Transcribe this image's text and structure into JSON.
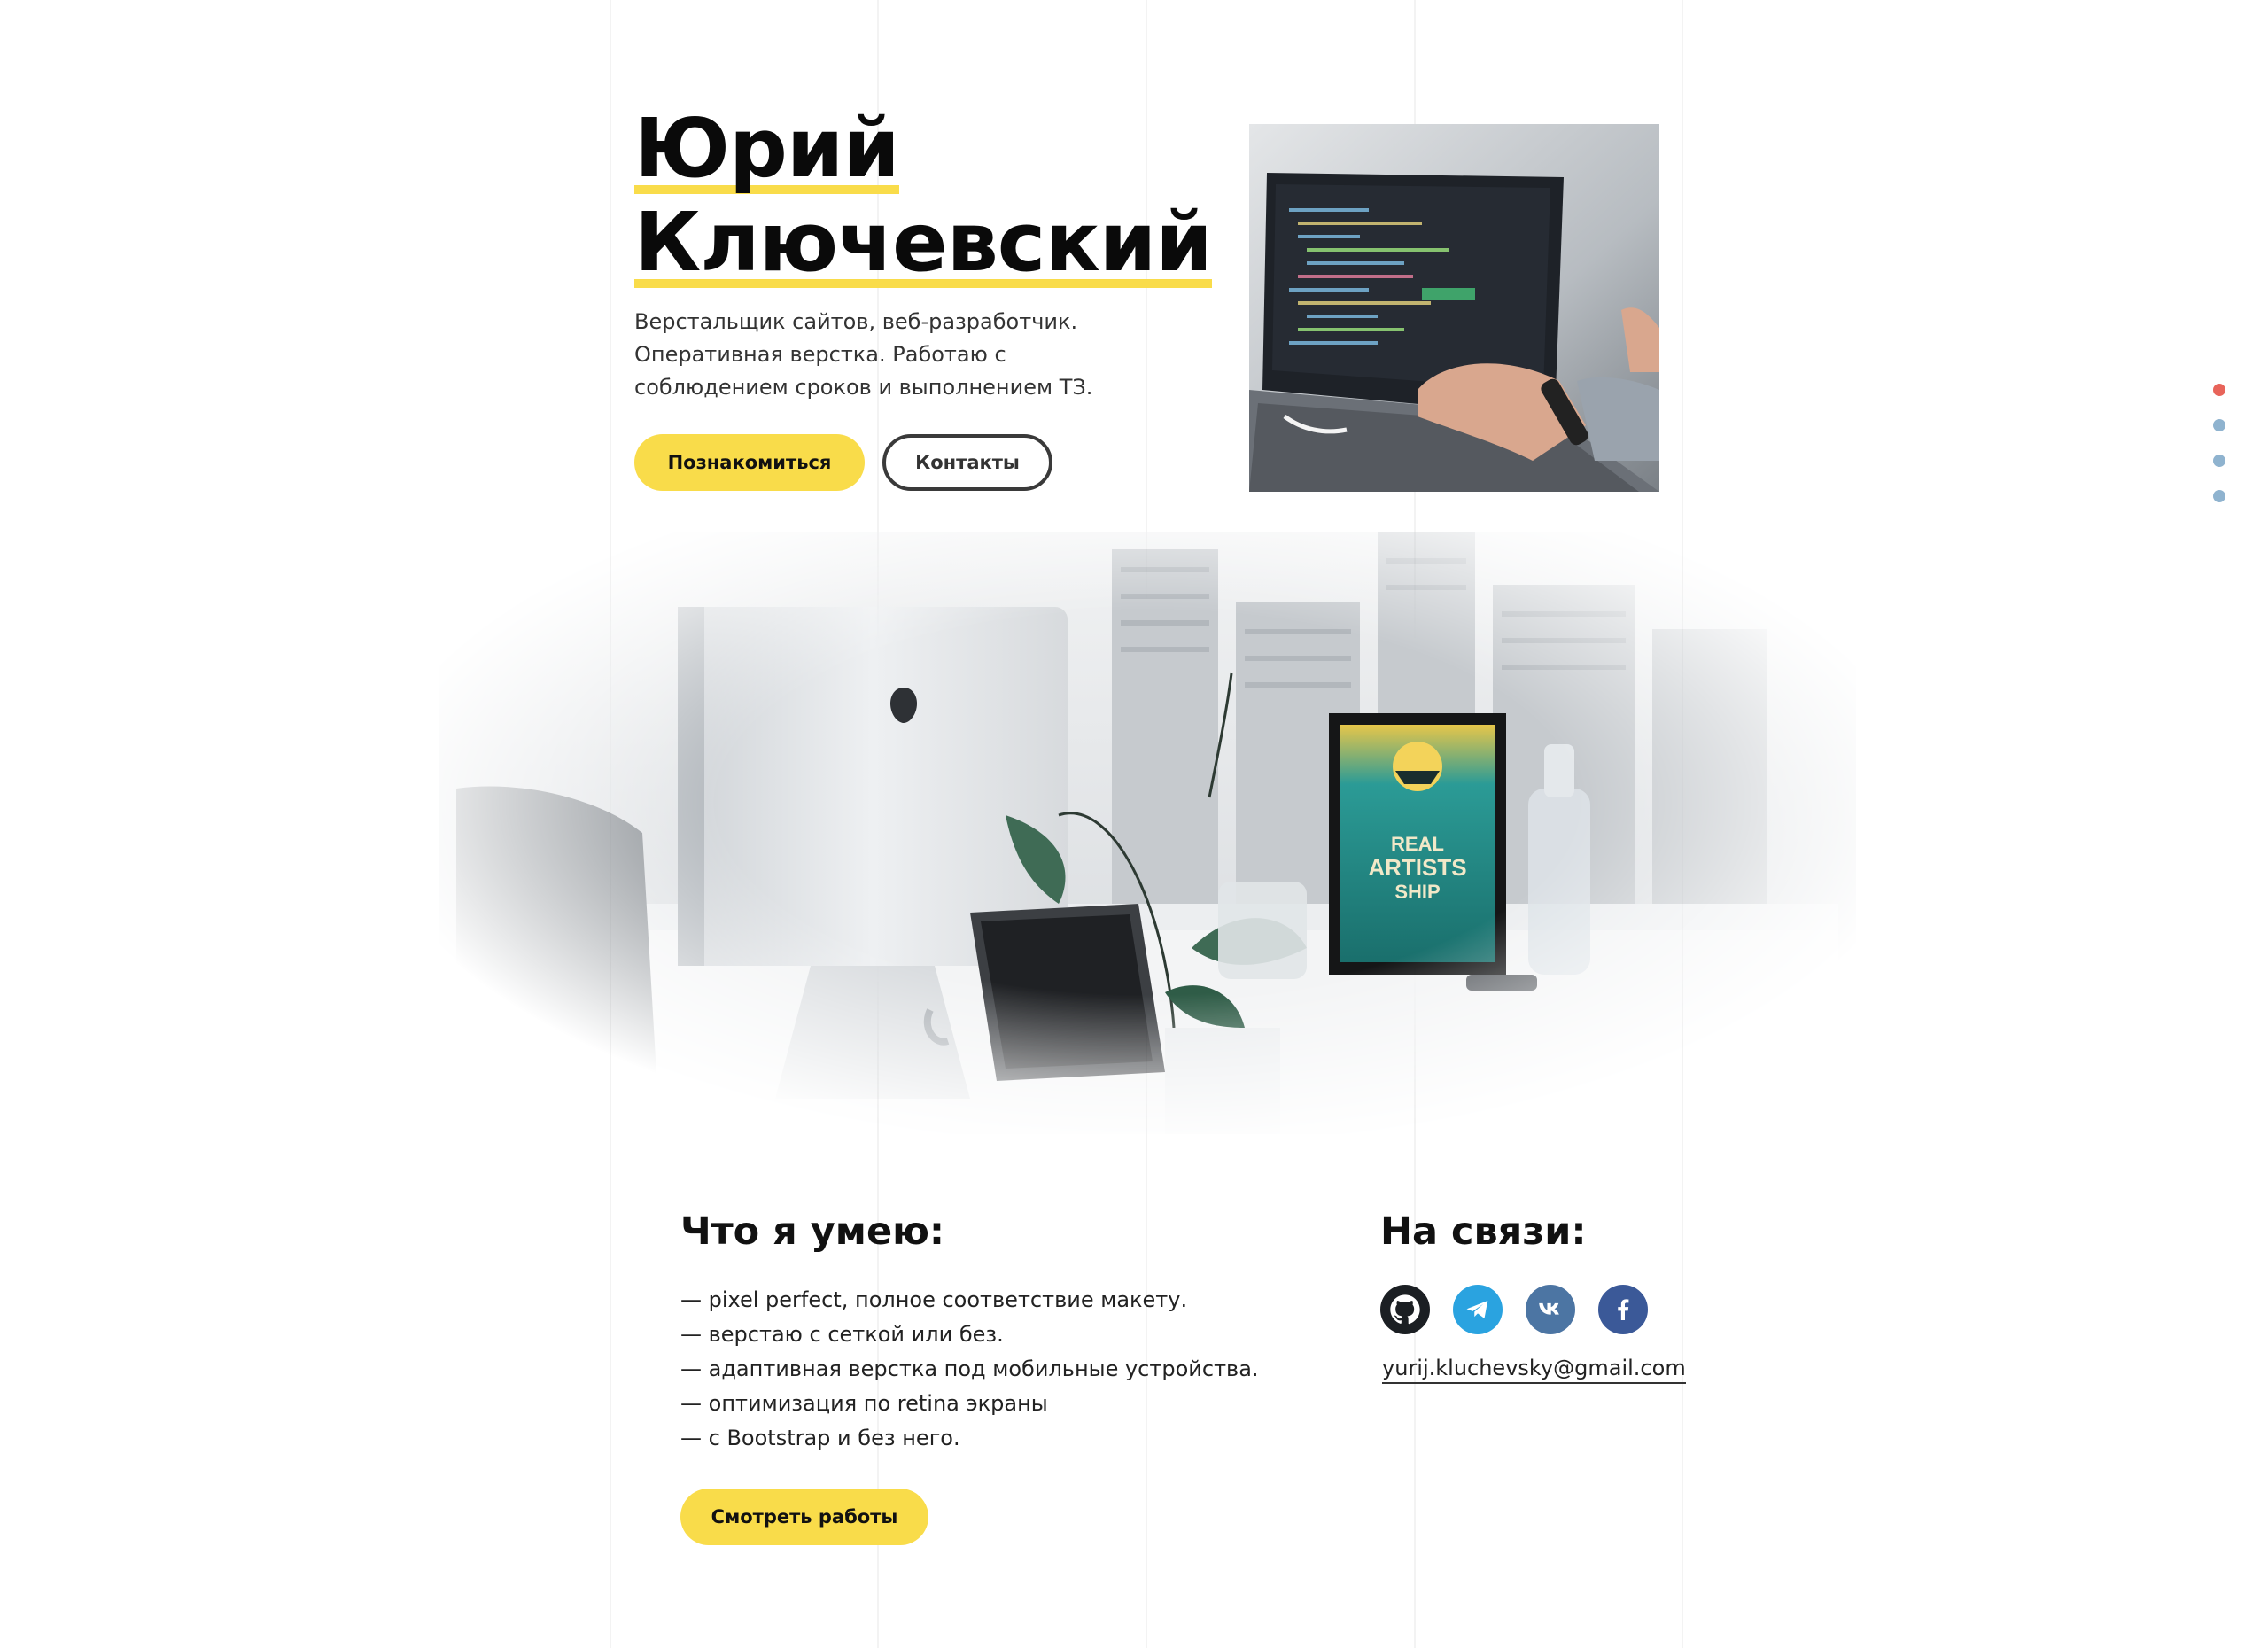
{
  "hero": {
    "name_first": "Юрий",
    "name_last": "Ключевский",
    "description": "Верстальщик сайтов, веб-разработчик. Оперативная верстка. Работаю с соблюдением сроков и выполнением ТЗ.",
    "primary_button": "Познакомиться",
    "secondary_button": "Контакты"
  },
  "side_nav": {
    "active_color": "#e8645a",
    "inactive_color": "#8fb3cf",
    "dots_count": 4
  },
  "workspace_poster": {
    "line1": "REAL",
    "line2": "ARTISTS",
    "line3": "SHIP"
  },
  "skills": {
    "title": "Что я умею:",
    "items": [
      "— pixel perfect, полное соответствие макету.",
      "— верстаю с сеткой или без.",
      "— адаптивная верстка под мобильные устройства.",
      "— оптимизация по retina экраны",
      "— с Bootstrap и без него."
    ],
    "button": "Смотреть работы"
  },
  "contacts": {
    "title": "На связи:",
    "email": "yurij.kluchevsky@gmail.com",
    "socials": [
      {
        "icon": "github-icon",
        "color": "#1b1f23"
      },
      {
        "icon": "telegram-icon",
        "color": "#2aa3e0"
      },
      {
        "icon": "vk-icon",
        "color": "#4c75a3"
      },
      {
        "icon": "facebook-icon",
        "color": "#3b5998"
      }
    ]
  },
  "colors": {
    "accent": "#f9dc4a",
    "text": "#111111"
  }
}
